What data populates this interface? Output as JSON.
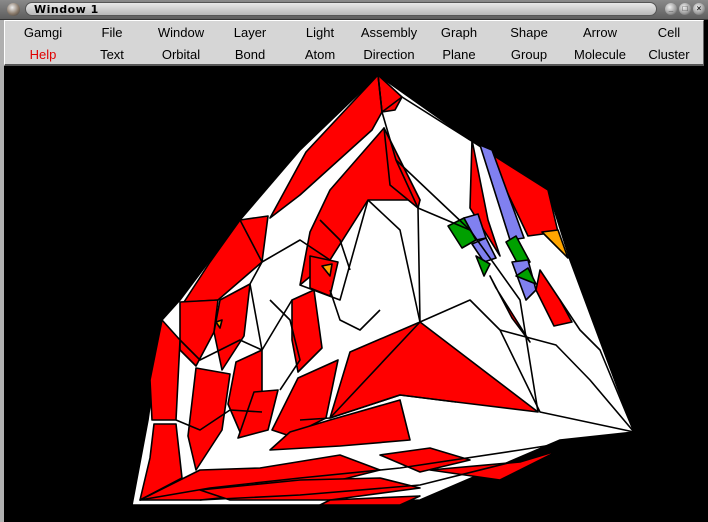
{
  "window": {
    "title": "Window 1",
    "controls": [
      "minimize",
      "maximize",
      "close"
    ]
  },
  "menubar": {
    "row1": [
      "Gamgi",
      "File",
      "Window",
      "Layer",
      "Light",
      "Assembly",
      "Graph",
      "Shape",
      "Arrow",
      "Cell"
    ],
    "row2": [
      "Help",
      "Text",
      "Orbital",
      "Bond",
      "Atom",
      "Direction",
      "Plane",
      "Group",
      "Molecule",
      "Cluster"
    ],
    "highlighted": "Help",
    "highlight_color": "#e00000"
  },
  "scene": {
    "description": "3D Voronoi-tessellated cube rendered in OpenGL viewport",
    "background": "#000000",
    "colors": {
      "red": "#ff0000",
      "white": "#ffffff",
      "green": "#00a000",
      "lavender": "#8080f0",
      "orange": "#ffa500",
      "edge": "#000000"
    }
  }
}
